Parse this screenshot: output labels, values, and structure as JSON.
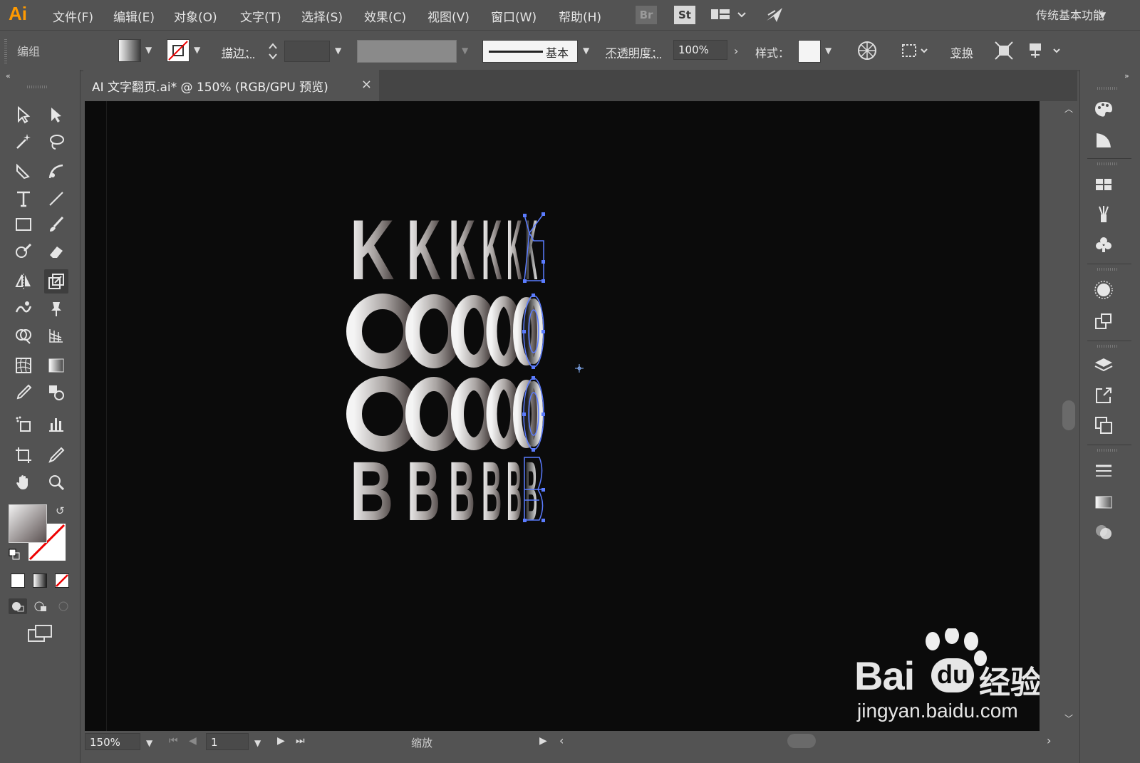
{
  "app": {
    "logo": "Ai"
  },
  "menu": [
    "文件(F)",
    "编辑(E)",
    "对象(O)",
    "文字(T)",
    "选择(S)",
    "效果(C)",
    "视图(V)",
    "窗口(W)",
    "帮助(H)"
  ],
  "menu_icons": {
    "bridge": "Br",
    "stock": "St"
  },
  "workspace": "传统基本功能",
  "control": {
    "selection_label": "编组",
    "stroke_label": "描边：",
    "stroke_profile": "基本",
    "opacity_label": "不透明度：",
    "opacity_value": "100%",
    "style_label": "样式：",
    "transform_label": "变换"
  },
  "document": {
    "tab_title": "AI 文字翻页.ai* @ 150% (RGB/GPU 预览)",
    "close": "×"
  },
  "artwork": {
    "letters": [
      "K",
      "O",
      "O",
      "B"
    ]
  },
  "status": {
    "zoom": "150%",
    "page": "1",
    "status_label": "缩放"
  },
  "watermark": {
    "brand": "Bai",
    "brand_suffix": "经验",
    "url": "jingyan.baidu.com"
  },
  "colors": {
    "ui_bg": "#535353",
    "canvas": "#0b0b0b",
    "selection": "#5b7cff",
    "logo": "#ff9a00"
  }
}
